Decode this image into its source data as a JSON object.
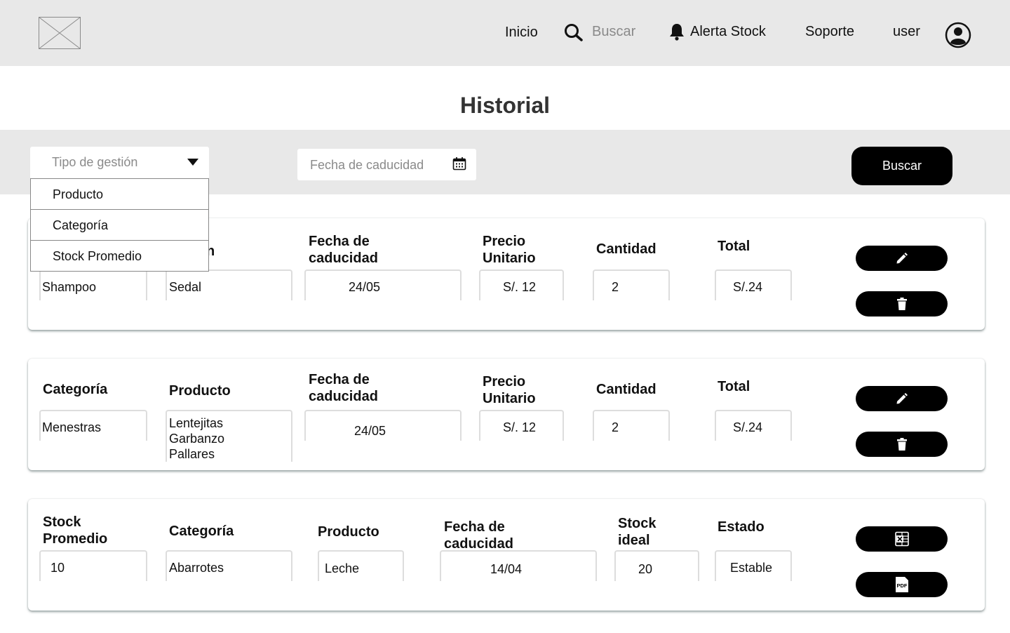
{
  "header": {
    "nav": {
      "inicio": "Inicio",
      "buscar": "Buscar",
      "alerta_stock": "Alerta Stock",
      "soporte": "Soporte",
      "user": "user"
    }
  },
  "page": {
    "title": "Historial"
  },
  "filters": {
    "tipo_gestion": {
      "placeholder": "Tipo de gestión",
      "options": [
        "Producto",
        "Categoría",
        "Stock Promedio"
      ],
      "expanded": true
    },
    "fecha_caducidad": {
      "placeholder": "Fecha de caducidad"
    },
    "search_button": "Buscar"
  },
  "cards": [
    {
      "type": "producto",
      "labels": {
        "col2_visible_fragment": "n",
        "fecha": "Fecha de\ncaducidad",
        "precio": "Precio\nUnitario",
        "cantidad": "Cantidad",
        "total": "Total"
      },
      "values": {
        "col1": "Shampoo",
        "col2": "Sedal",
        "fecha": "24/05",
        "precio": "S/. 12",
        "cantidad": "2",
        "total": "S/.24"
      },
      "actions": [
        "edit-icon",
        "trash-icon"
      ]
    },
    {
      "type": "categoria",
      "labels": {
        "categoria": "Categoría",
        "producto": "Producto",
        "fecha": "Fecha de\ncaducidad",
        "precio": "Precio\nUnitario",
        "cantidad": "Cantidad",
        "total": "Total"
      },
      "values": {
        "categoria": "Menestras",
        "producto": "Lentejitas\nGarbanzo\nPallares",
        "fecha": "24/05",
        "precio": "S/. 12",
        "cantidad": "2",
        "total": "S/.24"
      },
      "actions": [
        "edit-icon",
        "trash-icon"
      ]
    },
    {
      "type": "stock_promedio",
      "labels": {
        "stock_promedio": "Stock\nPromedio",
        "categoria": "Categoría",
        "producto": "Producto",
        "fecha": "Fecha de\ncaducidad",
        "stock_ideal": "Stock\nideal",
        "estado": "Estado"
      },
      "values": {
        "stock_promedio": "10",
        "categoria": "Abarrotes",
        "producto": "Leche",
        "fecha": "14/04",
        "stock_ideal": "20",
        "estado": "Estable"
      },
      "actions": [
        "excel-icon",
        "pdf-icon"
      ],
      "action_icon_text": {
        "pdf": "PDF"
      }
    }
  ]
}
